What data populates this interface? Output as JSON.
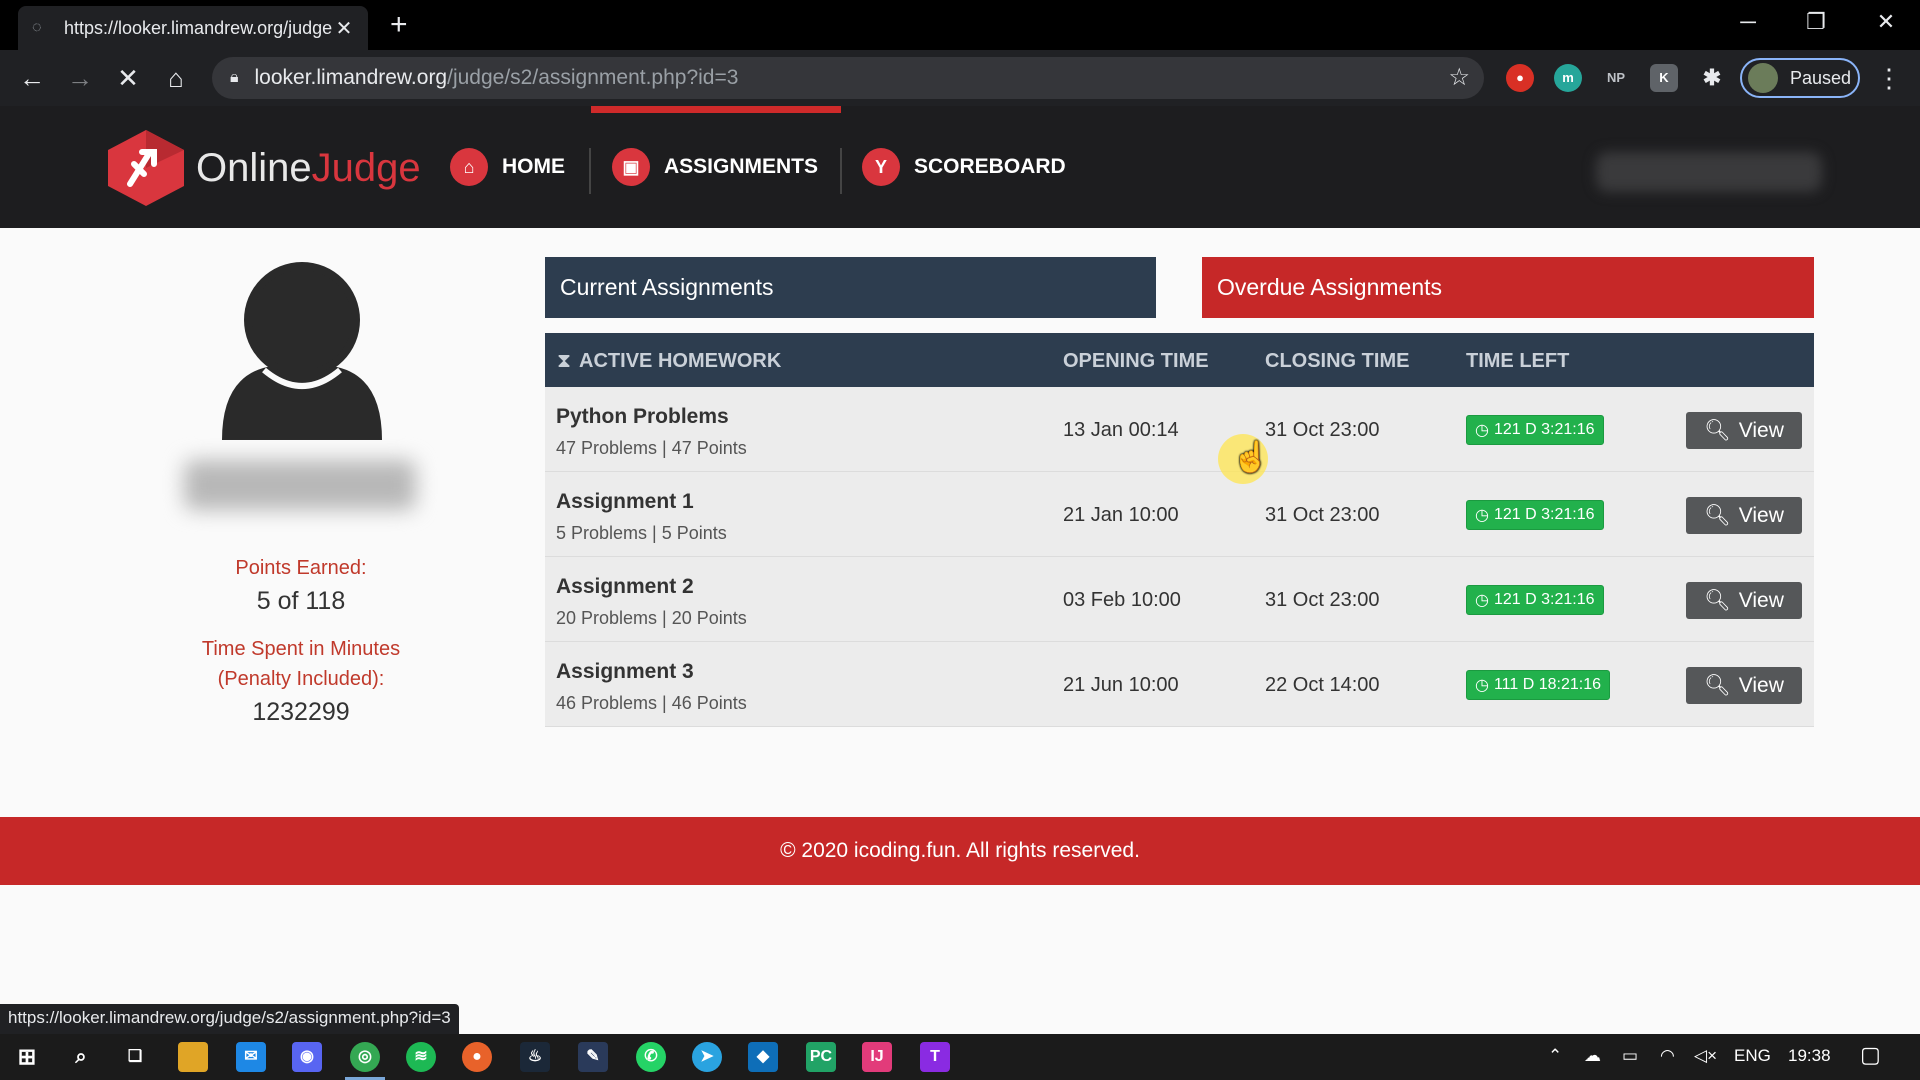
{
  "browser": {
    "tab_title": "https://looker.limandrew.org/judge",
    "tab_close": "✕",
    "new_tab": "+",
    "url_host": "looker.limandrew.org",
    "url_path": "/judge/s2/assignment.php?id=3",
    "extensions": [
      "NP"
    ],
    "profile_status": "Paused",
    "status_url": "https://looker.limandrew.org/judge/s2/assignment.php?id=3"
  },
  "site": {
    "brand_part1": "Online",
    "brand_part2": "Judge",
    "nav": [
      {
        "label": "HOME",
        "icon": "home-icon"
      },
      {
        "label": "ASSIGNMENTS",
        "icon": "book-icon"
      },
      {
        "label": "SCOREBOARD",
        "icon": "trophy-icon"
      }
    ],
    "active_nav": "ASSIGNMENTS"
  },
  "profile": {
    "points_label": "Points Earned:",
    "points_value": "5 of 118",
    "time_label_1": "Time Spent in Minutes",
    "time_label_2": "(Penalty Included):",
    "time_value": "1232299"
  },
  "panels": {
    "current": "Current Assignments",
    "overdue": "Overdue Assignments"
  },
  "table": {
    "headers": [
      "ACTIVE HOMEWORK",
      "OPENING TIME",
      "CLOSING TIME",
      "TIME LEFT"
    ],
    "rows": [
      {
        "name": "Python Problems",
        "meta": "47 Problems | 47 Points",
        "open": "13 Jan 00:14",
        "close": "31 Oct 23:00",
        "left": "121 D 3:21:16",
        "action": "View"
      },
      {
        "name": "Assignment 1",
        "meta": "5 Problems | 5 Points",
        "open": "21 Jan 10:00",
        "close": "31 Oct 23:00",
        "left": "121 D 3:21:16",
        "action": "View"
      },
      {
        "name": "Assignment 2",
        "meta": "20 Problems | 20 Points",
        "open": "03 Feb 10:00",
        "close": "31 Oct 23:00",
        "left": "121 D 3:21:16",
        "action": "View"
      },
      {
        "name": "Assignment 3",
        "meta": "46 Problems | 46 Points",
        "open": "21 Jun 10:00",
        "close": "22 Oct 14:00",
        "left": "111 D 18:21:16",
        "action": "View"
      }
    ]
  },
  "footer": {
    "text": "© 2020 icoding.fun. All rights reserved."
  },
  "taskbar": {
    "language": "ENG",
    "time": "19:38"
  },
  "colors": {
    "brand_red": "#c62828",
    "navy": "#2d3d4f",
    "badge_green": "#22b14c"
  }
}
